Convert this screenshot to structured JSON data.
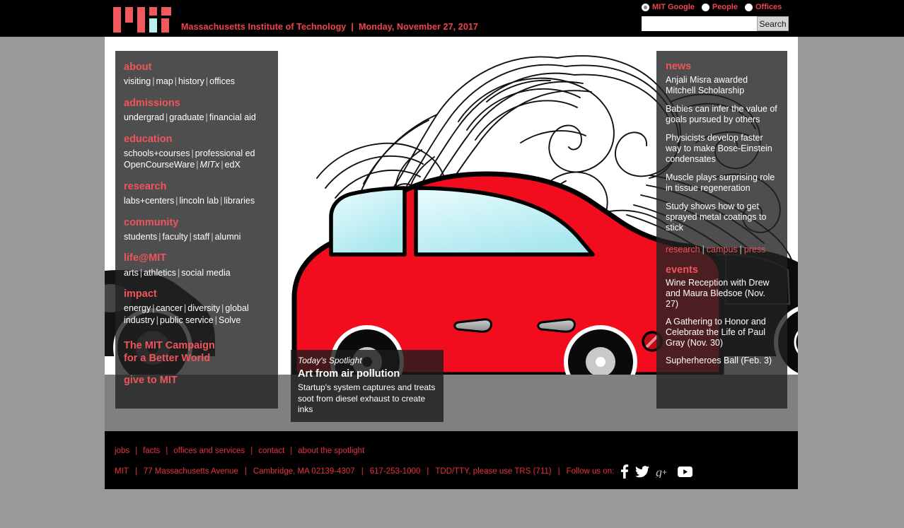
{
  "colors": {
    "accent_red": "#f0545c",
    "link_red": "#e8323c",
    "page_bg": "#999999",
    "panel_bg": "rgba(34,34,34,0.80)",
    "car_red": "#f20d1e",
    "window_blue": "#b8eef2"
  },
  "header": {
    "logo_name": "MIT",
    "institute": "Massachusetts Institute of Technology",
    "separator": "|",
    "date": "Monday, November 27, 2017"
  },
  "search": {
    "options": [
      {
        "label": "MIT Google",
        "selected": true
      },
      {
        "label": "People",
        "selected": false
      },
      {
        "label": "Offices",
        "selected": false
      }
    ],
    "value": "",
    "placeholder": "",
    "button_label": "Search"
  },
  "sidebar": {
    "groups": [
      {
        "heading": "about",
        "links": [
          "visiting",
          "map",
          "history",
          "offices"
        ]
      },
      {
        "heading": "admissions",
        "links": [
          "undergrad",
          "graduate",
          "financial aid"
        ]
      },
      {
        "heading": "education",
        "links": [
          "schools+courses",
          "professional ed",
          "OpenCourseWare",
          "MITx",
          "edX"
        ],
        "italic": [
          "MITx"
        ],
        "break_after": 2
      },
      {
        "heading": "research",
        "links": [
          "labs+centers",
          "lincoln lab",
          "libraries"
        ]
      },
      {
        "heading": "community",
        "links": [
          "students",
          "faculty",
          "staff",
          "alumni"
        ]
      },
      {
        "heading": "life@MIT",
        "links": [
          "arts",
          "athletics",
          "social media"
        ]
      },
      {
        "heading": "impact",
        "links": [
          "energy",
          "cancer",
          "diversity",
          "global",
          "industry",
          "public service",
          "Solve"
        ],
        "break_after": 4
      }
    ],
    "campaign_line1": "The MIT Campaign",
    "campaign_line2": "for a Better World",
    "give": "give to MIT"
  },
  "news": {
    "heading": "news",
    "items": [
      "Anjali Misra awarded Mitchell Scholarship",
      "Babies can infer the value of goals pursued by others",
      "Physicists develop faster way to make Bose-Einstein condensates",
      "Muscle plays surprising role in tissue regeneration",
      "Study shows how to get sprayed metal coatings to stick"
    ],
    "categories": [
      "research",
      "campus",
      "press"
    ]
  },
  "events": {
    "heading": "events",
    "items": [
      "Wine Reception with Drew and Maura Bledsoe (Nov. 27)",
      "A Gathering to Honor and Celebrate the Life of Paul Gray (Nov. 30)",
      "Supherheroes Ball (Feb. 3)"
    ]
  },
  "spotlight": {
    "kicker": "Today's Spotlight",
    "title": "Art from air pollution",
    "description": "Startup's system captures and treats soot from diesel exhaust to create inks"
  },
  "footer": {
    "links": [
      "jobs",
      "facts",
      "offices and services",
      "contact",
      "about the spotlight"
    ],
    "address": [
      "MIT",
      "77 Massachusetts Avenue",
      "Cambridge, MA 02139-4307",
      "617-253-1000",
      "TDD/TTY, please use TRS (711)"
    ],
    "follow_label": "Follow us on:",
    "social": [
      "facebook-icon",
      "twitter-icon",
      "google-plus-icon",
      "youtube-icon"
    ]
  }
}
